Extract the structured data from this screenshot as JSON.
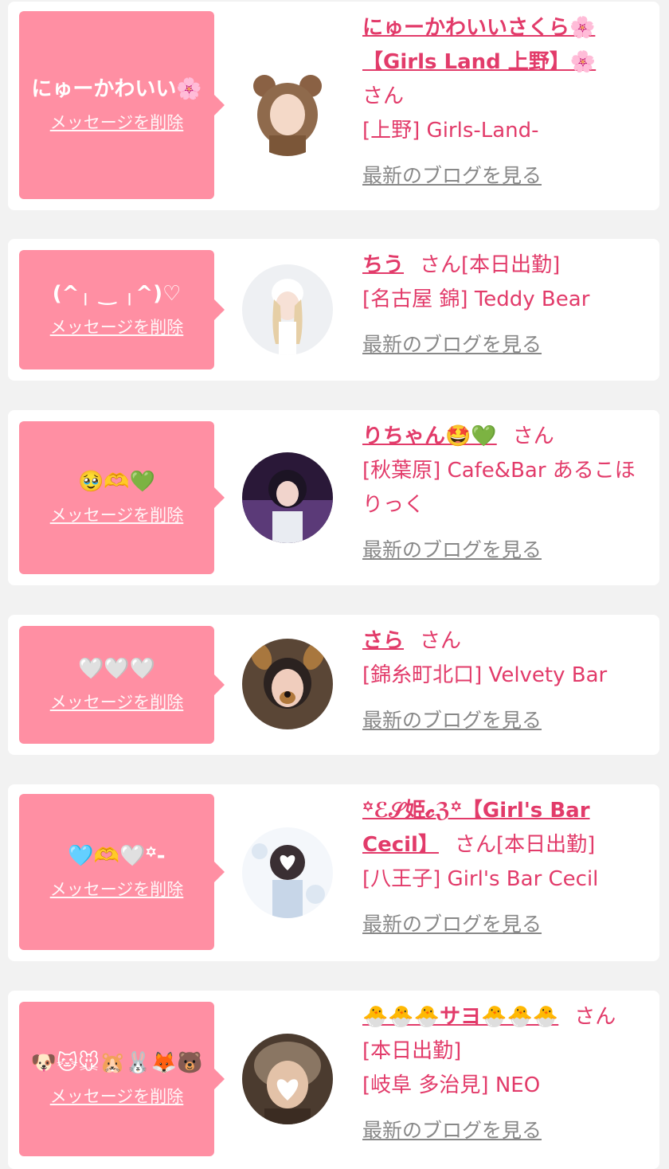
{
  "messages": [
    {
      "bubble_text": "にゅーかわいい🌸",
      "delete_label": "メッセージを削除",
      "name": "にゅーかわいいさくら🌸【Girls Land 上野】🌸",
      "honorific": "さん",
      "duty": "",
      "shop": "[上野] Girls-Land-",
      "blog_label": "最新のブログを見る"
    },
    {
      "bubble_text": "(^╷ ‿ ╷^)♡",
      "delete_label": "メッセージを削除",
      "name": "ちう",
      "honorific": "さん",
      "duty": "[本日出勤]",
      "shop": "[名古屋 錦] Teddy Bear",
      "blog_label": "最新のブログを見る"
    },
    {
      "bubble_text": "🥹🫶💚",
      "delete_label": "メッセージを削除",
      "name": "りちゃん🤩💚",
      "honorific": "さん",
      "duty": "",
      "shop": "[秋葉原] Cafe&Bar あるこほりっく",
      "blog_label": "最新のブログを見る"
    },
    {
      "bubble_text": "🤍🤍🤍",
      "delete_label": "メッセージを削除",
      "name": "さら",
      "honorific": "さん",
      "duty": "",
      "shop": "[錦糸町北口] Velvety Bar",
      "blog_label": "最新のブログを見る"
    },
    {
      "bubble_text": "🩵🫶🤍꙳-",
      "delete_label": "メッセージを削除",
      "name": "꙳ℰ𝒮姫𝓬ℨ꙳【Girl's Bar Cecil】",
      "honorific": "さん",
      "duty": "[本日出勤]",
      "shop": "[八王子] Girl's Bar Cecil",
      "blog_label": "最新のブログを見る"
    },
    {
      "bubble_text": "🐶🐱🐭🐹🐰🦊🐻",
      "delete_label": "メッセージを削除",
      "name": "🐣🐣🐣サヨ🐣🐣🐣",
      "honorific": "さん",
      "duty": "[本日出勤]",
      "shop": "[岐阜 多治見] NEO",
      "blog_label": "最新のブログを見る"
    }
  ],
  "colors": {
    "accent": "#e23b6a",
    "bubble": "#ff8fa3",
    "card": "#ffffff",
    "background": "#f2f2f2",
    "blog_link": "#888888"
  }
}
